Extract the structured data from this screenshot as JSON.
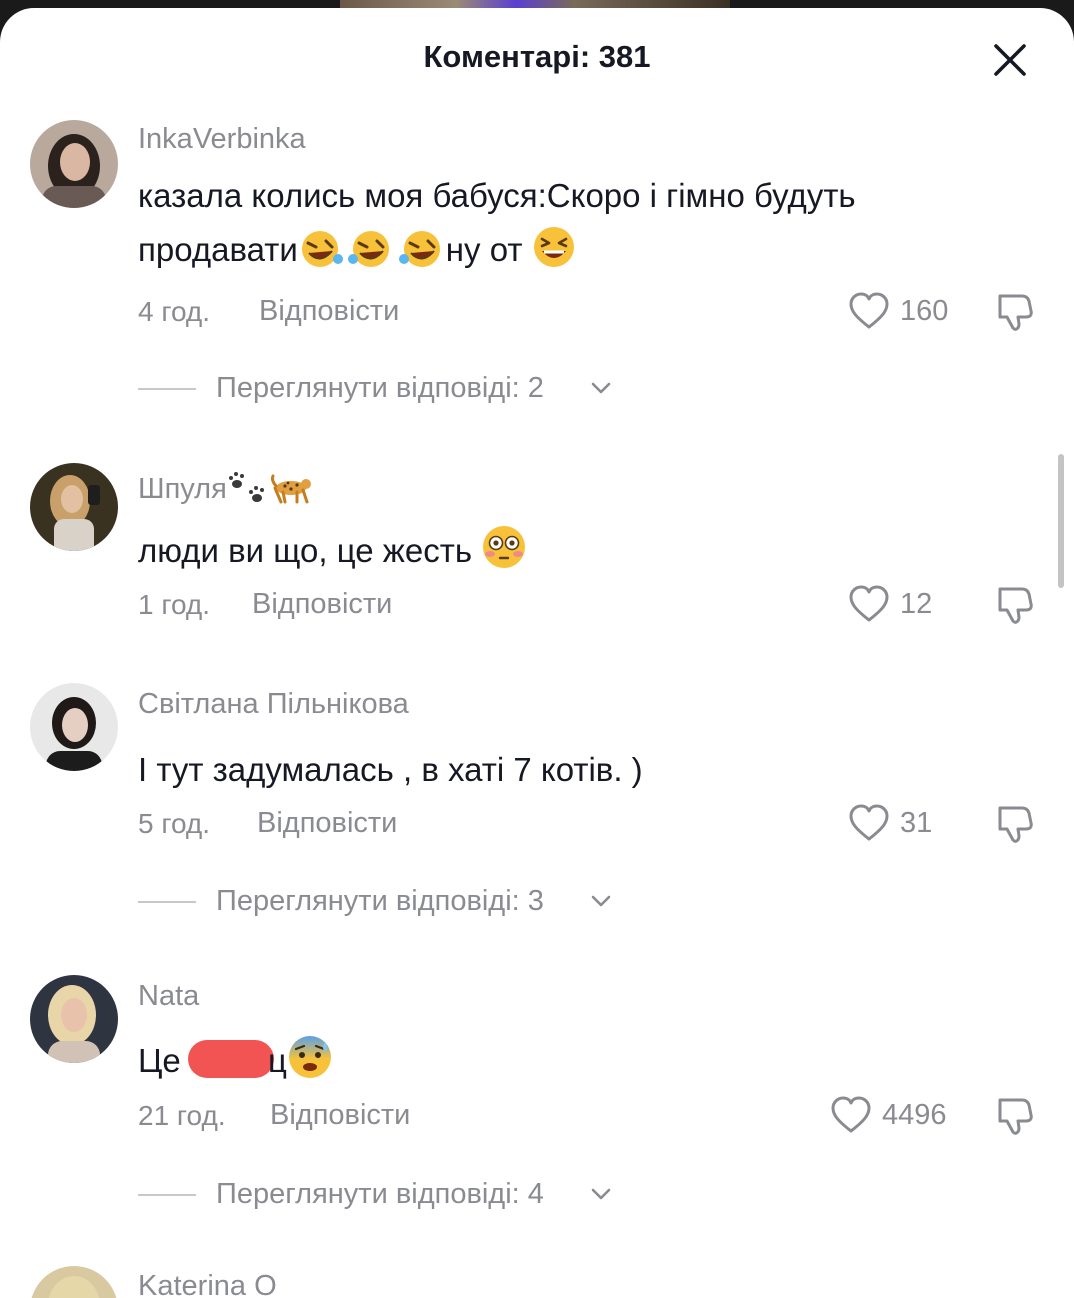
{
  "header": {
    "title": "Коментарі: 381"
  },
  "comments": [
    {
      "username": "InkaVerbinka",
      "text_1": "казала колись моя бабуся:Скоро і гімно будуть",
      "text_2a": "продавати",
      "text_2b": "ну от",
      "time": "4 год.",
      "reply": "Відповісти",
      "likes": "160",
      "view_replies": "Переглянути відповіді: 2"
    },
    {
      "username": "Шпуля",
      "text": "люди ви що, це жесть",
      "time": "1 год.",
      "reply": "Відповісти",
      "likes": "12"
    },
    {
      "username": "Світлана Пільнікова",
      "text": "І тут задумалась , в хаті 7 котів. )",
      "time": "5 год.",
      "reply": "Відповісти",
      "likes": "31",
      "view_replies": "Переглянути відповіді: 3"
    },
    {
      "username": "Nata",
      "text_a": "Це",
      "text_b": "ц",
      "time": "21 год.",
      "reply": "Відповісти",
      "likes": "4496",
      "view_replies": "Переглянути відповіді: 4"
    },
    {
      "username": "Katerina O"
    }
  ],
  "icons": {
    "close": "close-icon",
    "like": "heart-outline-icon",
    "dislike": "thumbs-down-outline-icon",
    "chevron": "chevron-down-icon",
    "emoji_laugh": "rolling-on-floor-laughing-emoji",
    "emoji_grin": "grinning-squinting-emoji",
    "emoji_flushed": "flushed-face-emoji",
    "emoji_anxious": "anxious-sweat-emoji"
  },
  "colors": {
    "text": "#161823",
    "secondary": "#8a8b91",
    "redaction": "#f25454"
  }
}
